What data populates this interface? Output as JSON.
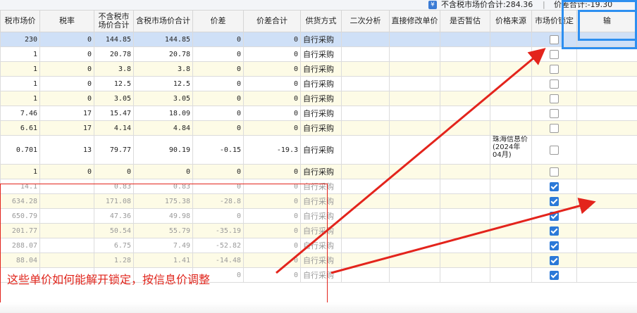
{
  "summary": {
    "currency_icon": "¥",
    "total_excl_tax": "不含税市场价合计:284.36",
    "separator": "|",
    "price_diff_total": "价差合计:-19.30"
  },
  "columns": [
    "税市场价",
    "税率",
    "不含税市场价合计",
    "含税市场价合计",
    "价差",
    "价差合计",
    "供货方式",
    "二次分析",
    "直接修改单价",
    "是否暂估",
    "价格来源",
    "市场价锁定",
    "输"
  ],
  "rows": [
    {
      "cells": [
        "230",
        "0",
        "144.85",
        "144.85",
        "0",
        "0",
        "自行采购",
        "",
        "",
        "",
        ""
      ],
      "locked": false
    },
    {
      "cells": [
        "1",
        "0",
        "20.78",
        "20.78",
        "0",
        "0",
        "自行采购",
        "",
        "",
        "",
        ""
      ],
      "locked": false
    },
    {
      "cells": [
        "1",
        "0",
        "3.8",
        "3.8",
        "0",
        "0",
        "自行采购",
        "",
        "",
        "",
        ""
      ],
      "locked": false
    },
    {
      "cells": [
        "1",
        "0",
        "12.5",
        "12.5",
        "0",
        "0",
        "自行采购",
        "",
        "",
        "",
        ""
      ],
      "locked": false
    },
    {
      "cells": [
        "1",
        "0",
        "3.05",
        "3.05",
        "0",
        "0",
        "自行采购",
        "",
        "",
        "",
        ""
      ],
      "locked": false
    },
    {
      "cells": [
        "7.46",
        "17",
        "15.47",
        "18.09",
        "0",
        "0",
        "自行采购",
        "",
        "",
        "",
        ""
      ],
      "locked": false
    },
    {
      "cells": [
        "6.61",
        "17",
        "4.14",
        "4.84",
        "0",
        "0",
        "自行采购",
        "",
        "",
        "",
        ""
      ],
      "locked": false
    },
    {
      "cells": [
        "0.701",
        "13",
        "79.77",
        "90.19",
        "-0.15",
        "-19.3",
        "自行采购",
        "",
        "",
        "",
        "珠海信息价(2024年04月)"
      ],
      "locked": false
    },
    {
      "cells": [
        "1",
        "0",
        "0",
        "0",
        "0",
        "0",
        "自行采购",
        "",
        "",
        "",
        ""
      ],
      "locked": false
    },
    {
      "cells": [
        "14.1",
        "",
        "0.83",
        "0.83",
        "0",
        "0",
        "自行采购",
        "",
        "",
        "",
        ""
      ],
      "locked": true
    },
    {
      "cells": [
        "634.28",
        "",
        "171.08",
        "175.38",
        "-28.8",
        "0",
        "自行采购",
        "",
        "",
        "",
        ""
      ],
      "locked": true
    },
    {
      "cells": [
        "650.79",
        "",
        "47.36",
        "49.98",
        "0",
        "0",
        "自行采购",
        "",
        "",
        "",
        ""
      ],
      "locked": true
    },
    {
      "cells": [
        "201.77",
        "",
        "50.54",
        "55.79",
        "-35.19",
        "0",
        "自行采购",
        "",
        "",
        "",
        ""
      ],
      "locked": true
    },
    {
      "cells": [
        "288.07",
        "",
        "6.75",
        "7.49",
        "-52.82",
        "0",
        "自行采购",
        "",
        "",
        "",
        ""
      ],
      "locked": true
    },
    {
      "cells": [
        "88.04",
        "",
        "1.28",
        "1.41",
        "-14.48",
        "0",
        "自行采购",
        "",
        "",
        "",
        ""
      ],
      "locked": true
    },
    {
      "cells": [
        "",
        "",
        "",
        "",
        "0",
        "0",
        "自行采购",
        "",
        "",
        "",
        ""
      ],
      "locked": true
    }
  ],
  "annotation": {
    "text": "这些单价如何能解开锁定，按信息价调整",
    "color": "#e3241c",
    "highlight_color": "#2d8ff0"
  },
  "colors": {
    "selected_row": "#cfe0f7",
    "alt_row": "#fdfbe6",
    "checkbox_checked": "#2b79d8"
  }
}
